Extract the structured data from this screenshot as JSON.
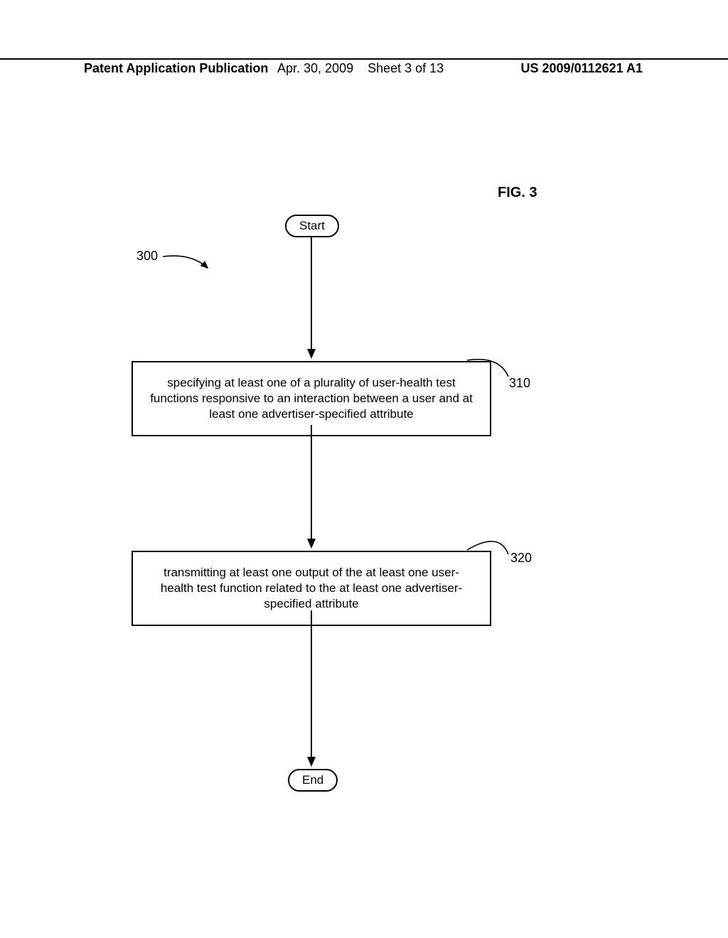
{
  "header": {
    "left": "Patent Application Publication",
    "date": "Apr. 30, 2009",
    "sheet": "Sheet 3 of 13",
    "pubnum": "US 2009/0112621 A1"
  },
  "figure_label": "FIG. 3",
  "refs": {
    "r300": "300",
    "r310": "310",
    "r320": "320"
  },
  "nodes": {
    "start": "Start",
    "end": "End",
    "box1": "specifying at least one of a plurality of user-health test functions responsive to an interaction between a user and at least one advertiser-specified attribute",
    "box2": "transmitting at least one output of the at least one user-health test function related to the at least one advertiser-specified attribute"
  }
}
